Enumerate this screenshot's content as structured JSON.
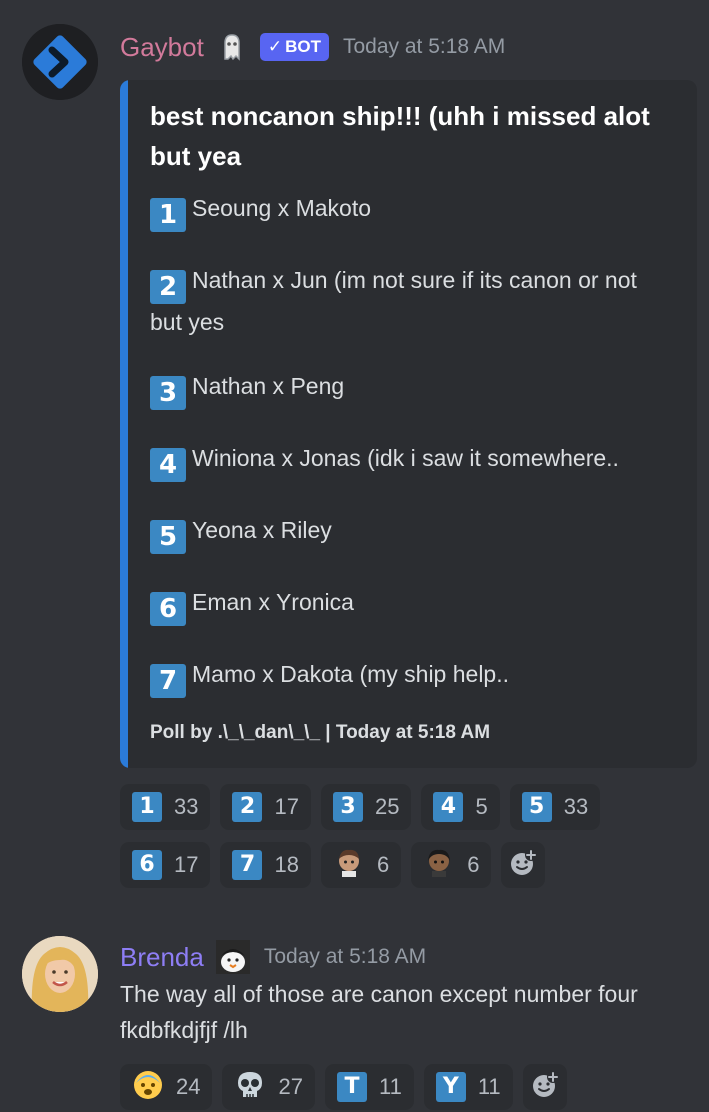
{
  "bot_message": {
    "username": "Gaybot",
    "badge": "BOT",
    "timestamp": "Today at 5:18 AM",
    "embed": {
      "title": "best noncanon ship!!! (uhh i missed alot but yea",
      "options": [
        {
          "key": "1",
          "text": "Seoung x Makoto"
        },
        {
          "key": "2",
          "text": "Nathan x Jun (im not sure if its canon or not but yes"
        },
        {
          "key": "3",
          "text": "Nathan x Peng"
        },
        {
          "key": "4",
          "text": "Winiona x Jonas (idk i saw it somewhere.."
        },
        {
          "key": "5",
          "text": "Yeona x Riley"
        },
        {
          "key": "6",
          "text": "Eman x Yronica"
        },
        {
          "key": "7",
          "text": "Mamo x Dakota (my ship help.."
        }
      ],
      "footer": "Poll by .\\_\\_dan\\_\\_ | Today at 5:18 AM"
    },
    "reactions": [
      {
        "key": "1",
        "count": "33"
      },
      {
        "key": "2",
        "count": "17"
      },
      {
        "key": "3",
        "count": "25"
      },
      {
        "key": "4",
        "count": "5"
      },
      {
        "key": "5",
        "count": "33"
      },
      {
        "key": "6",
        "count": "17"
      },
      {
        "key": "7",
        "count": "18"
      },
      {
        "emoji": "custom-emoji-1",
        "count": "6"
      },
      {
        "emoji": "custom-emoji-2",
        "count": "6"
      }
    ]
  },
  "user_message": {
    "username": "Brenda",
    "timestamp": "Today at 5:18 AM",
    "text": "The way all of those are canon except number four fkdbfkdjfjf /lh",
    "reactions": [
      {
        "emoji": "😨",
        "count": "24"
      },
      {
        "emoji": "💀",
        "count": "27"
      },
      {
        "key": "T",
        "count": "11"
      },
      {
        "key": "Y",
        "count": "11"
      }
    ]
  },
  "colors": {
    "background": "#313338",
    "embed_bg": "#2b2d31",
    "embed_bar": "#2b7bd9",
    "bot_name": "#d27a9b",
    "user_name": "#8e7ef5",
    "bot_badge": "#5865f2",
    "keycap": "#3b88c3"
  }
}
